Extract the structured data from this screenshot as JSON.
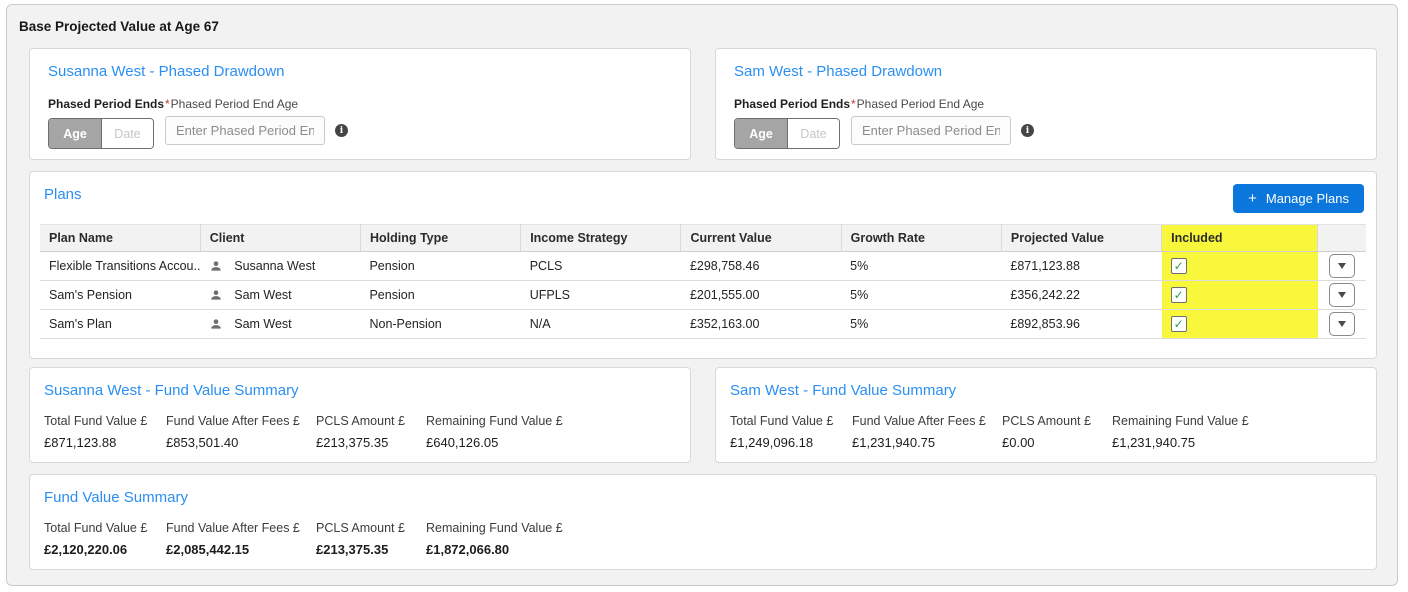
{
  "page": {
    "title": "Base Projected Value at Age 67"
  },
  "phased_cards": [
    {
      "heading": "Susanna West - Phased Drawdown",
      "toggle_label": "Phased Period Ends",
      "toggle_options": [
        "Age",
        "Date"
      ],
      "selected_option": "Age",
      "required_mark": "*",
      "field_label": "Phased Period End Age",
      "input_value": "",
      "input_placeholder": "Enter Phased Period End Age"
    },
    {
      "heading": "Sam West - Phased Drawdown",
      "toggle_label": "Phased Period Ends",
      "toggle_options": [
        "Age",
        "Date"
      ],
      "selected_option": "Age",
      "required_mark": "*",
      "field_label": "Phased Period End Age",
      "input_value": "",
      "input_placeholder": "Enter Phased Period End Age"
    }
  ],
  "plans": {
    "heading": "Plans",
    "manage_button": {
      "icon": "plus-icon",
      "label": "Manage Plans"
    },
    "table": {
      "columns": [
        "Plan Name",
        "Client",
        "Holding Type",
        "Income Strategy",
        "Current Value",
        "Growth Rate",
        "Projected Value",
        "Included"
      ],
      "rows": [
        {
          "plan_name": "Flexible Transitions Accou...",
          "client": "Susanna West",
          "holding_type": "Pension",
          "income_strategy": "PCLS",
          "current_value": "£298,758.46",
          "growth_rate": "5%",
          "projected_value": "£871,123.88",
          "included": true
        },
        {
          "plan_name": "Sam's Pension",
          "client": "Sam West",
          "holding_type": "Pension",
          "income_strategy": "UFPLS",
          "current_value": "£201,555.00",
          "growth_rate": "5%",
          "projected_value": "£356,242.22",
          "included": true
        },
        {
          "plan_name": "Sam's Plan",
          "client": "Sam West",
          "holding_type": "Non-Pension",
          "income_strategy": "N/A",
          "current_value": "£352,163.00",
          "growth_rate": "5%",
          "projected_value": "£892,853.96",
          "included": true
        }
      ]
    }
  },
  "summaries": [
    {
      "heading": "Susanna West - Fund Value Summary",
      "items": [
        {
          "label": "Total Fund Value £",
          "value": "£871,123.88"
        },
        {
          "label": "Fund Value After Fees £",
          "value": "£853,501.40"
        },
        {
          "label": "PCLS Amount £",
          "value": "£213,375.35"
        },
        {
          "label": "Remaining Fund Value £",
          "value": "£640,126.05"
        }
      ]
    },
    {
      "heading": "Sam West - Fund Value Summary",
      "items": [
        {
          "label": "Total Fund Value £",
          "value": "£1,249,096.18"
        },
        {
          "label": "Fund Value After Fees £",
          "value": "£1,231,940.75"
        },
        {
          "label": "PCLS Amount £",
          "value": "£0.00"
        },
        {
          "label": "Remaining Fund Value £",
          "value": "£1,231,940.75"
        }
      ]
    },
    {
      "heading": "Fund Value Summary",
      "items": [
        {
          "label": "Total Fund Value £",
          "value": "£2,120,220.06"
        },
        {
          "label": "Fund Value After Fees £",
          "value": "£2,085,442.15"
        },
        {
          "label": "PCLS Amount £",
          "value": "£213,375.35"
        },
        {
          "label": "Remaining Fund Value £",
          "value": "£1,872,066.80"
        }
      ]
    }
  ],
  "colors": {
    "accent_blue": "#2b8ff2",
    "button_blue": "#0b77dc",
    "highlight_yellow": "#f8f73b",
    "check_green": "#2f9e44",
    "required_red": "#c23934",
    "page_background": "#f2f2f3"
  }
}
